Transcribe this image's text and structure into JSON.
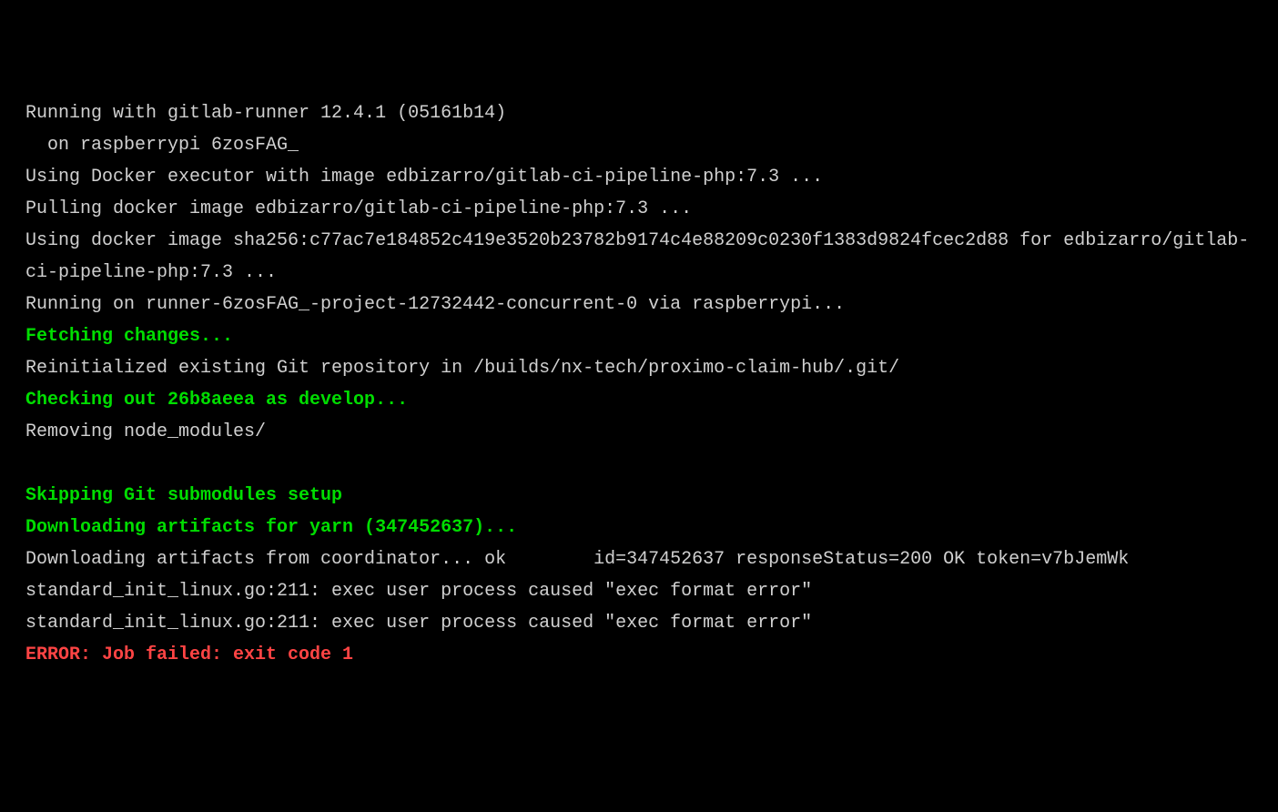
{
  "terminal": {
    "lines": [
      {
        "text": "Running with gitlab-runner 12.4.1 (05161b14)",
        "style": "normal"
      },
      {
        "text": "  on raspberrypi 6zosFAG_",
        "style": "normal"
      },
      {
        "text": "Using Docker executor with image edbizarro/gitlab-ci-pipeline-php:7.3 ...",
        "style": "normal"
      },
      {
        "text": "Pulling docker image edbizarro/gitlab-ci-pipeline-php:7.3 ...",
        "style": "normal"
      },
      {
        "text": "Using docker image sha256:c77ac7e184852c419e3520b23782b9174c4e88209c0230f1383d9824fcec2d88 for edbizarro/gitlab-ci-pipeline-php:7.3 ...",
        "style": "normal"
      },
      {
        "text": "Running on runner-6zosFAG_-project-12732442-concurrent-0 via raspberrypi...",
        "style": "normal"
      },
      {
        "text": "Fetching changes...",
        "style": "green"
      },
      {
        "text": "Reinitialized existing Git repository in /builds/nx-tech/proximo-claim-hub/.git/",
        "style": "normal"
      },
      {
        "text": "Checking out 26b8aeea as develop...",
        "style": "green"
      },
      {
        "text": "Removing node_modules/",
        "style": "normal"
      },
      {
        "text": " ",
        "style": "normal"
      },
      {
        "text": "Skipping Git submodules setup",
        "style": "green"
      },
      {
        "text": "Downloading artifacts for yarn (347452637)...",
        "style": "green"
      },
      {
        "text": "Downloading artifacts from coordinator... ok        id=347452637 responseStatus=200 OK token=v7bJemWk",
        "style": "normal"
      },
      {
        "text": "standard_init_linux.go:211: exec user process caused \"exec format error\"",
        "style": "normal"
      },
      {
        "text": "standard_init_linux.go:211: exec user process caused \"exec format error\"",
        "style": "normal"
      },
      {
        "text": "ERROR: Job failed: exit code 1",
        "style": "red"
      }
    ]
  }
}
